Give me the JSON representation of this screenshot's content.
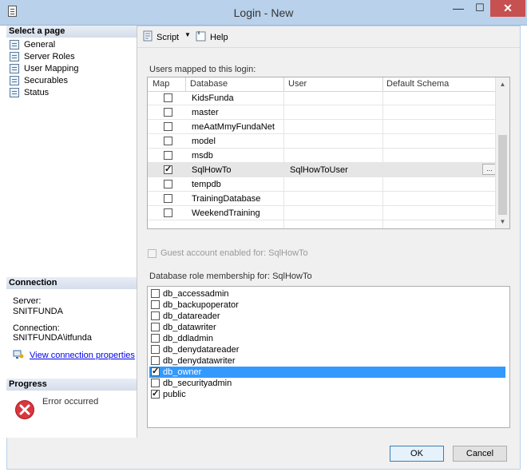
{
  "window": {
    "title": "Login - New",
    "minimize_glyph": "—",
    "maximize_glyph": "☐",
    "close_glyph": "✕"
  },
  "sidebar": {
    "select_page_header": "Select a page",
    "pages": [
      {
        "label": "General",
        "icon": "page-icon"
      },
      {
        "label": "Server Roles",
        "icon": "page-icon"
      },
      {
        "label": "User Mapping",
        "icon": "page-icon"
      },
      {
        "label": "Securables",
        "icon": "page-icon"
      },
      {
        "label": "Status",
        "icon": "page-icon"
      }
    ],
    "connection_header": "Connection",
    "server_label": "Server:",
    "server_value": "SNITFUNDA",
    "connection_label": "Connection:",
    "connection_value": "SNITFUNDA\\itfunda",
    "view_connection_link": "View connection properties",
    "progress_header": "Progress",
    "progress_status": "Error occurred"
  },
  "toolbar": {
    "script_label": "Script",
    "help_label": "Help"
  },
  "mapping": {
    "section_label": "Users mapped to this login:",
    "columns": [
      "Map",
      "Database",
      "User",
      "Default Schema"
    ],
    "rows": [
      {
        "map": false,
        "database": "KidsFunda",
        "user": "",
        "schema": "",
        "selected": false
      },
      {
        "map": false,
        "database": "master",
        "user": "",
        "schema": "",
        "selected": false
      },
      {
        "map": false,
        "database": "meAatMmyFundaNet",
        "user": "",
        "schema": "",
        "selected": false
      },
      {
        "map": false,
        "database": "model",
        "user": "",
        "schema": "",
        "selected": false
      },
      {
        "map": false,
        "database": "msdb",
        "user": "",
        "schema": "",
        "selected": false
      },
      {
        "map": true,
        "database": "SqlHowTo",
        "user": "SqlHowToUser",
        "schema": "",
        "selected": true
      },
      {
        "map": false,
        "database": "tempdb",
        "user": "",
        "schema": "",
        "selected": false
      },
      {
        "map": false,
        "database": "TrainingDatabase",
        "user": "",
        "schema": "",
        "selected": false
      },
      {
        "map": false,
        "database": "WeekendTraining",
        "user": "",
        "schema": "",
        "selected": false
      }
    ],
    "ellipsis_label": "..."
  },
  "guest_account": {
    "label": "Guest account enabled for: SqlHowTo",
    "checked": false,
    "enabled": false
  },
  "roles": {
    "section_label": "Database role membership for: SqlHowTo",
    "items": [
      {
        "name": "db_accessadmin",
        "checked": false,
        "selected": false
      },
      {
        "name": "db_backupoperator",
        "checked": false,
        "selected": false
      },
      {
        "name": "db_datareader",
        "checked": false,
        "selected": false
      },
      {
        "name": "db_datawriter",
        "checked": false,
        "selected": false
      },
      {
        "name": "db_ddladmin",
        "checked": false,
        "selected": false
      },
      {
        "name": "db_denydatareader",
        "checked": false,
        "selected": false
      },
      {
        "name": "db_denydatawriter",
        "checked": false,
        "selected": false
      },
      {
        "name": "db_owner",
        "checked": true,
        "selected": true
      },
      {
        "name": "db_securityadmin",
        "checked": false,
        "selected": false
      },
      {
        "name": "public",
        "checked": true,
        "selected": false
      }
    ]
  },
  "buttons": {
    "ok_label": "OK",
    "cancel_label": "Cancel"
  },
  "colors": {
    "titlebar": "#b9d1ea",
    "selection": "#3399ff",
    "close": "#c75050",
    "error": "#d9363e"
  }
}
